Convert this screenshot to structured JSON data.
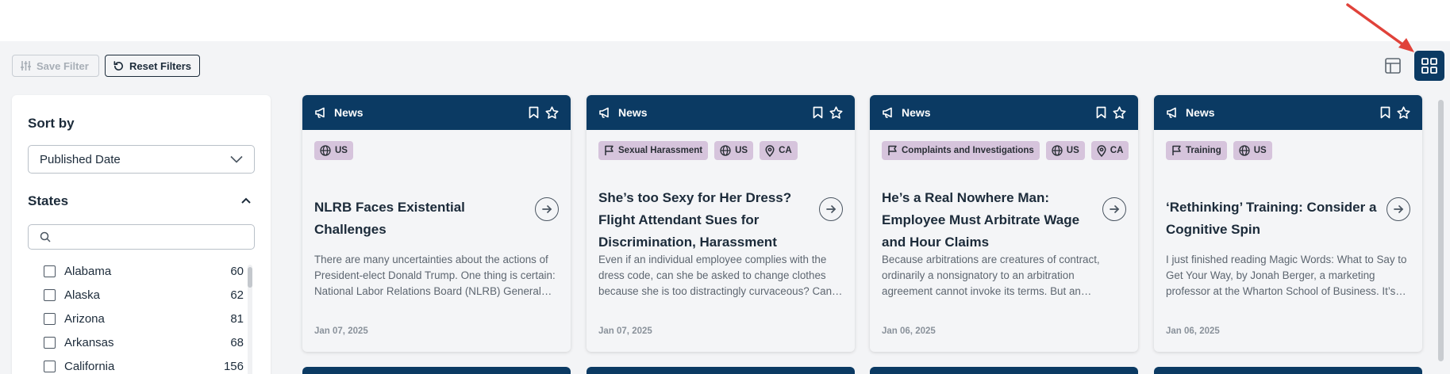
{
  "toolbar": {
    "save_filter_label": "Save Filter",
    "reset_filters_label": "Reset Filters",
    "save_icon": "sliders-icon",
    "reset_icon": "reset-icon",
    "table_view_icon": "table-view-icon",
    "grid_view_icon": "grid-view-icon"
  },
  "sidebar": {
    "sort_title": "Sort by",
    "sort_value": "Published Date",
    "states_title": "States",
    "search_placeholder": "",
    "states": [
      {
        "name": "Alabama",
        "count": "60"
      },
      {
        "name": "Alaska",
        "count": "62"
      },
      {
        "name": "Arizona",
        "count": "81"
      },
      {
        "name": "Arkansas",
        "count": "68"
      },
      {
        "name": "California",
        "count": "156"
      }
    ]
  },
  "cards": [
    {
      "type": "News",
      "tags": [
        {
          "icon": "globe-icon",
          "label": "US"
        }
      ],
      "title": "NLRB Faces Existential Challenges",
      "description": "There are many uncertainties about the actions of President-elect Donald Trump. One thing is certain: National Labor Relations Board (NLRB) General Counsel (GC) Jennifer Abruzzo will be...",
      "date": "Jan 07, 2025"
    },
    {
      "type": "News",
      "tags": [
        {
          "icon": "flag-icon",
          "label": "Sexual Harassment"
        },
        {
          "icon": "globe-icon",
          "label": "US"
        },
        {
          "icon": "map-pin-icon",
          "label": "CA"
        }
      ],
      "title": "She’s too Sexy for Her Dress? Flight Attendant Sues for Discrimination, Harassment",
      "description": "Even if an individual employee complies with the dress code, can she be asked to change clothes because she is too distractingly curvaceous? Can she be terminated for inappropriate social media...",
      "date": "Jan 07, 2025"
    },
    {
      "type": "News",
      "tags": [
        {
          "icon": "flag-icon",
          "label": "Complaints and Investigations"
        },
        {
          "icon": "globe-icon",
          "label": "US"
        },
        {
          "icon": "map-pin-icon",
          "label": "CA"
        }
      ],
      "title": "He’s a Real Nowhere Man: Employee Must Arbitrate Wage and Hour Claims",
      "description": "Because arbitrations are creatures of contract, ordinarily a nonsignatory to an arbitration agreement cannot invoke its terms. But an exception exists when that rule proves just too...",
      "date": "Jan 06, 2025"
    },
    {
      "type": "News",
      "tags": [
        {
          "icon": "flag-icon",
          "label": "Training"
        },
        {
          "icon": "globe-icon",
          "label": "US"
        }
      ],
      "title": "‘Rethinking’ Training: Consider a Cognitive Spin",
      "description": "I just finished reading Magic Words: What to Say to Get Your Way, by Jonah Berger, a marketing professor at the Wharton School of Business. It’s especially useful to HR professionals, who are...",
      "date": "Jan 06, 2025"
    }
  ],
  "colors": {
    "header_navy": "#0b3a63",
    "tag_bg": "#d6c4dc",
    "page_bg": "#f3f4f6",
    "annotation_arrow": "#e0423a"
  }
}
